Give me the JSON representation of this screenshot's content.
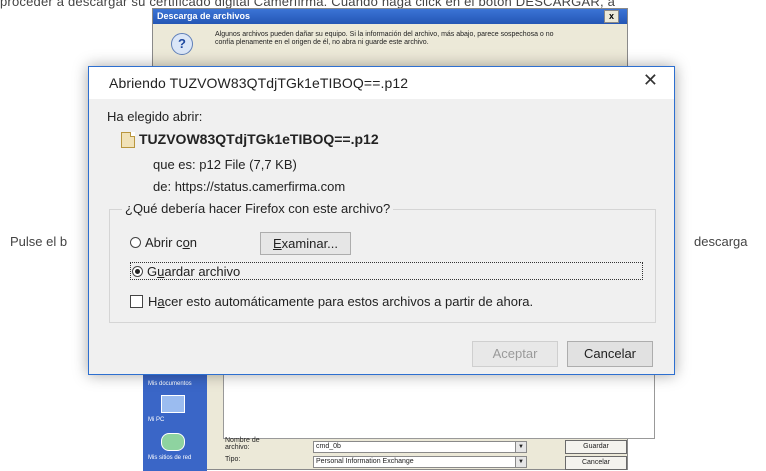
{
  "background": {
    "top_text": "proceder a descargar su certificado digital Camerfirma. Cuando haga click en el botón DESCARGAR, a",
    "left_text": "Pulse el b",
    "right_text": "descarga",
    "old_dialog": {
      "title": "Descarga de archivos",
      "close_glyph": "x",
      "message": "Algunos archivos pueden dañar su equipo. Si la información del archivo, más abajo, parece sospechosa o no confía plenamente en el origen de él, no abra ni guarde este archivo.",
      "sidebar_items": [
        "Mis documentos",
        "Mi PC",
        "Mis sitios de red"
      ],
      "filename_label": "Nombre de archivo:",
      "filename_value": "cmd_0b",
      "type_label": "Tipo:",
      "type_value": "Personal Information Exchange",
      "save_label": "Guardar",
      "cancel_label": "Cancelar"
    }
  },
  "dialog": {
    "title": "Abriendo TUZVOW83QTdjTGk1eTIBOQ==.p12",
    "close_glyph": "✕",
    "chosen_label": "Ha elegido abrir:",
    "file_name": "TUZVOW83QTdjTGk1eTIBOQ==.p12",
    "type_label": "que es:",
    "type_value": "p12 File (7,7 KB)",
    "from_label": "de:",
    "from_value": "https://status.camerfirma.com",
    "question": "¿Qué debería hacer Firefox con este archivo?",
    "open_with": {
      "prefix": "Abrir c",
      "access_key": "o",
      "suffix": "n",
      "checked": false
    },
    "browse_button": {
      "access_key": "E",
      "rest": "xaminar..."
    },
    "save_file": {
      "prefix": "G",
      "access_key": "u",
      "suffix": "ardar archivo",
      "checked": true
    },
    "auto_checkbox": {
      "prefix": "H",
      "access_key": "a",
      "suffix": "cer esto automáticamente para estos archivos a partir de ahora.",
      "checked": false
    },
    "accept_label": "Aceptar",
    "cancel_label": "Cancelar"
  }
}
